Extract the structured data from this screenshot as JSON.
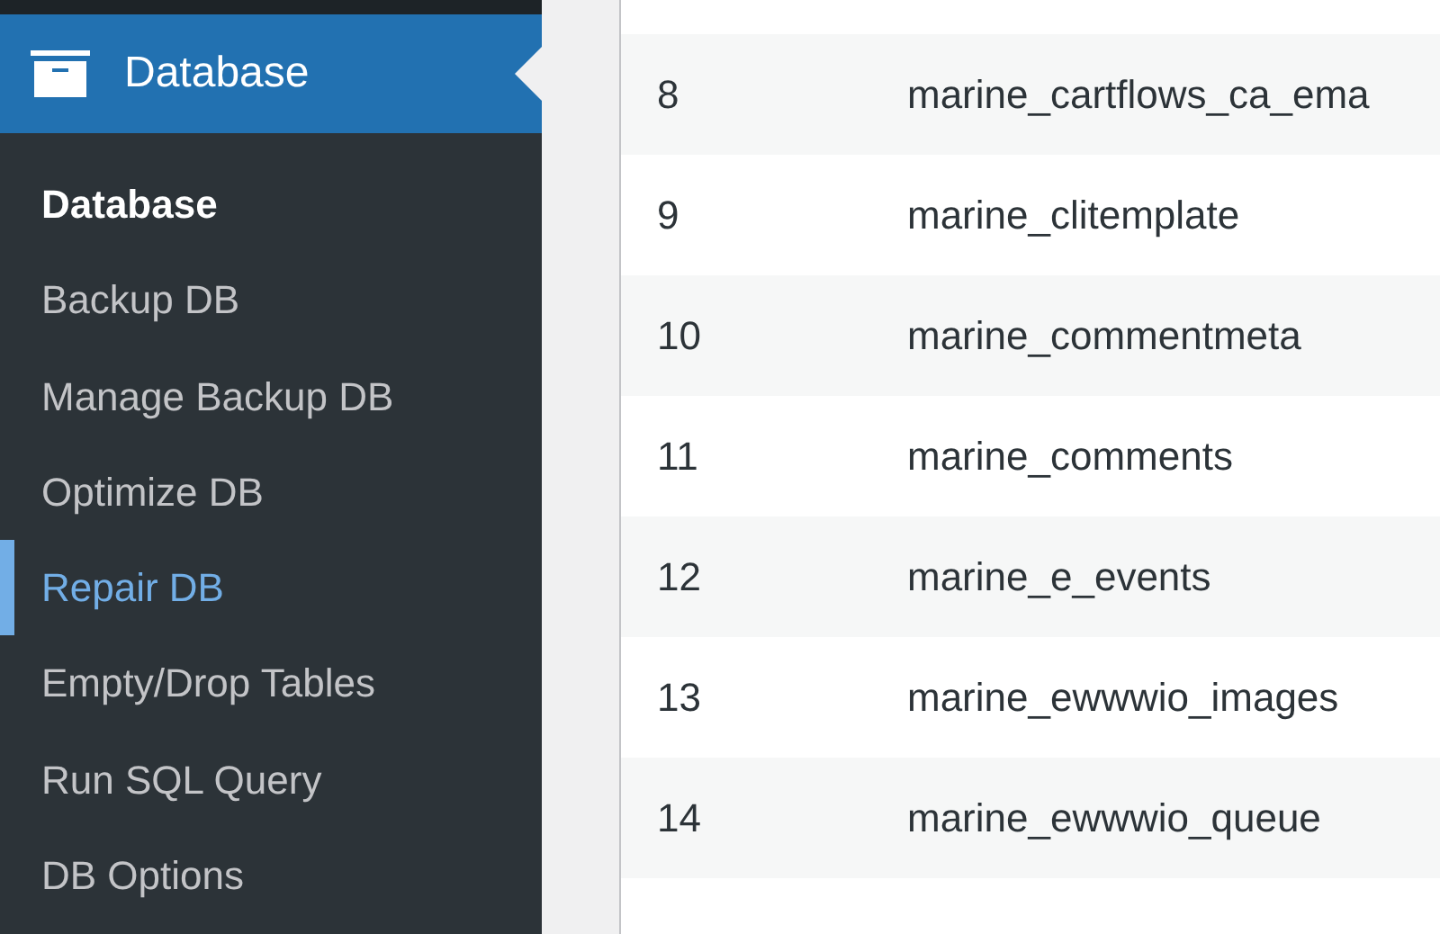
{
  "sidebar": {
    "menu_header": {
      "label": "Database",
      "selected": true
    },
    "items": [
      {
        "label": "Database",
        "selected": true,
        "highlighted": false
      },
      {
        "label": "Backup DB",
        "selected": false,
        "highlighted": false
      },
      {
        "label": "Manage Backup DB",
        "selected": false,
        "highlighted": false
      },
      {
        "label": "Optimize DB",
        "selected": false,
        "highlighted": false
      },
      {
        "label": "Repair DB",
        "selected": false,
        "highlighted": true
      },
      {
        "label": "Empty/Drop Tables",
        "selected": false,
        "highlighted": false
      },
      {
        "label": "Run SQL Query",
        "selected": false,
        "highlighted": false
      },
      {
        "label": "DB Options",
        "selected": false,
        "highlighted": false
      }
    ]
  },
  "table": {
    "rows": [
      {
        "number": "8",
        "name": "marine_cartflows_ca_ema"
      },
      {
        "number": "9",
        "name": "marine_clitemplate"
      },
      {
        "number": "10",
        "name": "marine_commentmeta"
      },
      {
        "number": "11",
        "name": "marine_comments"
      },
      {
        "number": "12",
        "name": "marine_e_events"
      },
      {
        "number": "13",
        "name": "marine_ewwwio_images"
      },
      {
        "number": "14",
        "name": "marine_ewwwio_queue"
      }
    ]
  }
}
